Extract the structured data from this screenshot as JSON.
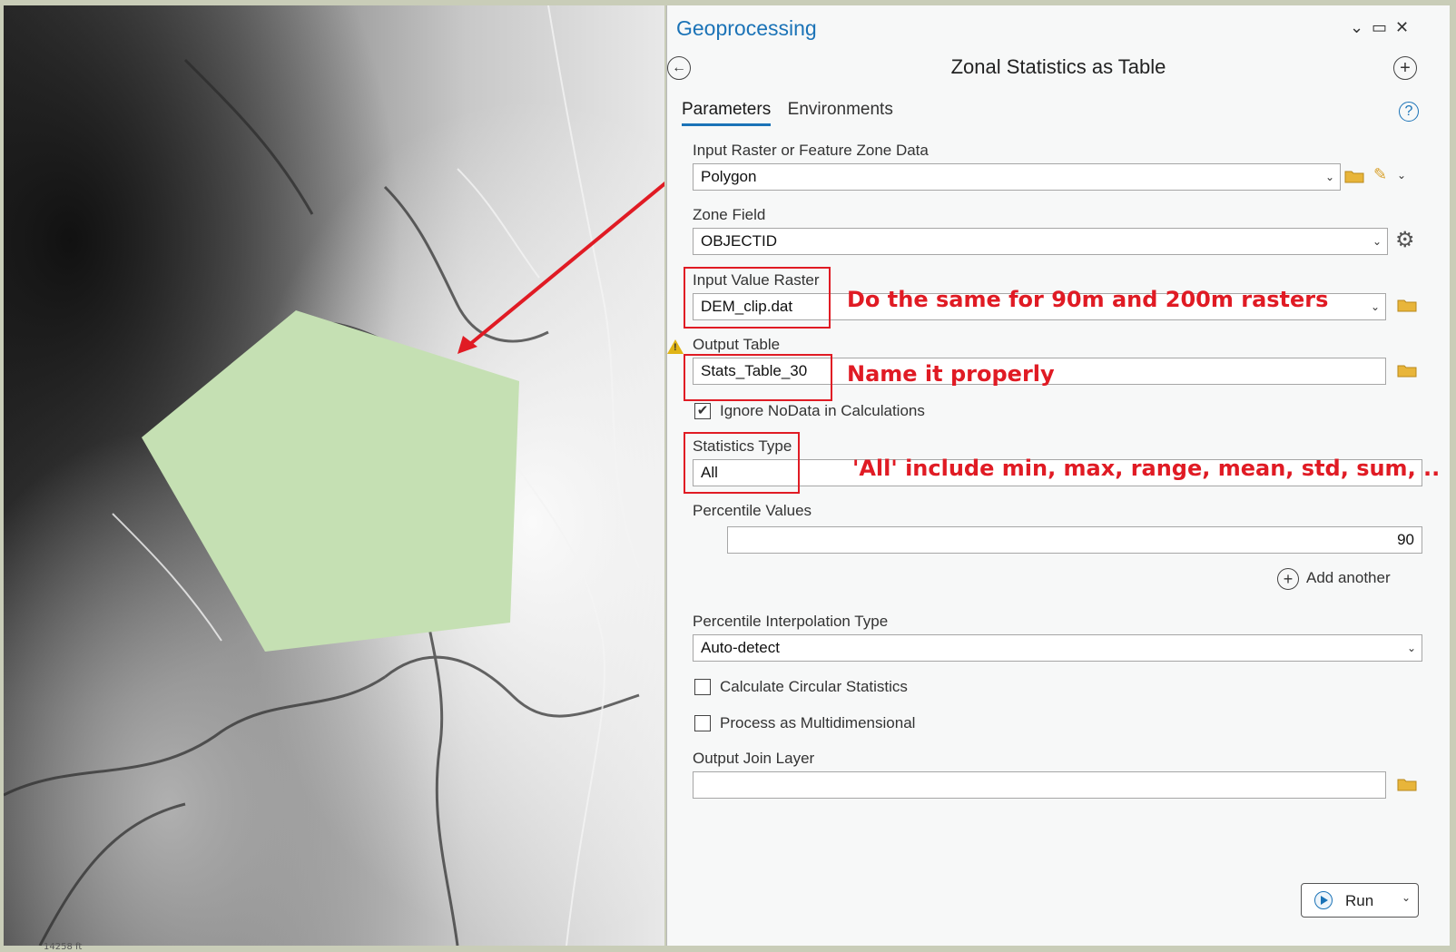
{
  "map": {
    "footer_text": "14258 ft"
  },
  "panel": {
    "title": "Geoprocessing",
    "tool_title": "Zonal Statistics as Table",
    "tabs": [
      {
        "label": "Parameters",
        "active": true
      },
      {
        "label": "Environments",
        "active": false
      }
    ],
    "colors": {
      "accent": "#1b73b7",
      "annotation": "#e01b24",
      "polygon_fill": "#c5e0b3"
    }
  },
  "params": {
    "input_zone": {
      "label": "Input Raster or Feature Zone Data",
      "value": "Polygon"
    },
    "zone_field": {
      "label": "Zone Field",
      "value": "OBJECTID"
    },
    "value_raster": {
      "label": "Input Value Raster",
      "value": "DEM_clip.dat"
    },
    "output_table": {
      "label": "Output Table",
      "value": "Stats_Table_30"
    },
    "ignore_nodata": {
      "label": "Ignore NoData in Calculations",
      "checked": true
    },
    "statistics_type": {
      "label": "Statistics Type",
      "value": "All"
    },
    "percentile_values": {
      "label": "Percentile Values",
      "value": "90"
    },
    "add_another": "Add another",
    "interp_type": {
      "label": "Percentile Interpolation Type",
      "value": "Auto-detect"
    },
    "circular_stats": {
      "label": "Calculate Circular Statistics",
      "checked": false
    },
    "multidim": {
      "label": "Process as Multidimensional",
      "checked": false
    },
    "join_layer": {
      "label": "Output Join Layer",
      "value": ""
    }
  },
  "annotations": {
    "a1": "Do the same for 90m and 200m rasters",
    "a2": "Name it properly",
    "a3": "'All' include min, max, range, mean, std, sum, .."
  },
  "run": {
    "label": "Run"
  }
}
